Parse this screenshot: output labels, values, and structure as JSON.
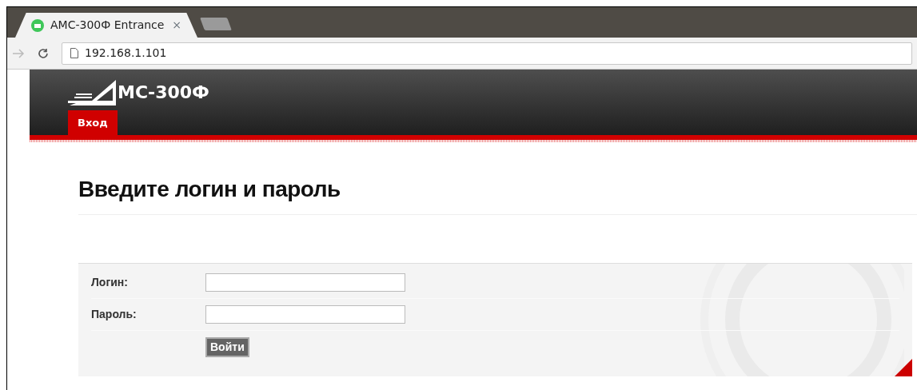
{
  "browser": {
    "tab_title": "АМС-300Ф Entrance",
    "tab_close": "×",
    "address": "192.168.1.101"
  },
  "header": {
    "logo_text": "МС-300Ф",
    "nav": [
      {
        "label": "Вход",
        "selected": true
      }
    ]
  },
  "heading": "Введите логин и пароль",
  "form": {
    "fields": [
      {
        "label": "Логин:"
      },
      {
        "label": "Пароль:"
      }
    ],
    "submit": "Войти"
  }
}
